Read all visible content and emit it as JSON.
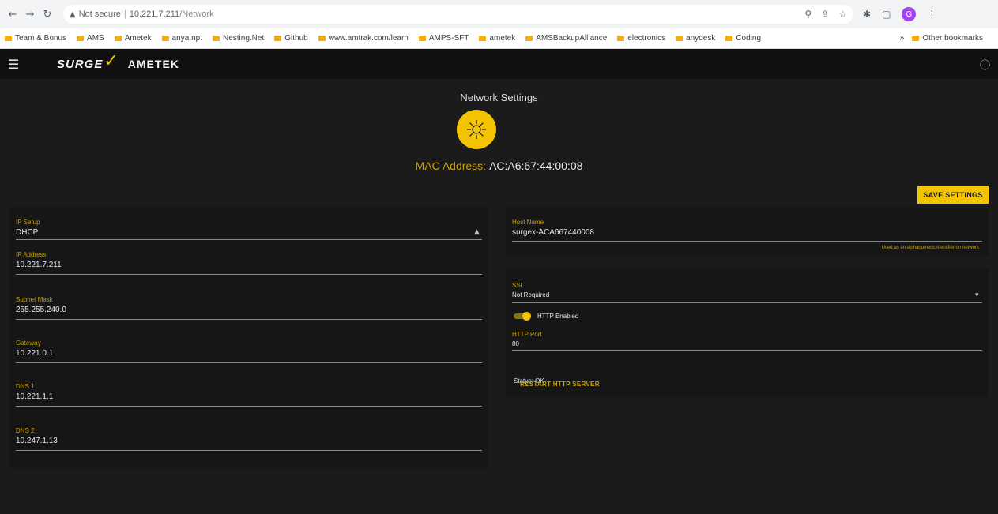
{
  "browser": {
    "url_security": "Not secure",
    "url_host": "10.221.7.211",
    "url_path": "/Network",
    "bookmarks": [
      "Team & Bonus",
      "AMS",
      "Ametek",
      "anya.npt",
      "Nesting.Net",
      "Github",
      "www.amtrak.com/learn",
      "AMPS-SFT",
      "ametek",
      "AMSBackupAlliance",
      "electronics",
      "anydesk",
      "Coding"
    ],
    "other_bookmarks": "Other bookmarks",
    "profile_initial": "G"
  },
  "app": {
    "logo_surge": "SURGE",
    "logo_ametek": "AMETEK",
    "page_title": "Network Settings",
    "mac_label": "MAC Address:",
    "mac_value": "AC:A6:67:44:00:08",
    "save_button": "SAVE SETTINGS"
  },
  "left_panel": {
    "ip_setup_label": "IP Setup",
    "ip_setup_value": "DHCP",
    "ip_address_label": "IP Address",
    "ip_address_value": "10.221.7.211",
    "subnet_label": "Subnet Mask",
    "subnet_value": "255.255.240.0",
    "gateway_label": "Gateway",
    "gateway_value": "10.221.0.1",
    "dns1_label": "DNS 1",
    "dns1_value": "10.221.1.1",
    "dns2_label": "DNS 2",
    "dns2_value": "10.247.1.13"
  },
  "right_panel": {
    "hostname_label": "Host Name",
    "hostname_value": "surgex-ACA667440008",
    "hostname_helper": "Used as an alphanumeric identifier on network",
    "ssl_label": "SSL",
    "ssl_value": "Not Required",
    "http_toggle_label": "HTTP Enabled",
    "http_enabled": true,
    "http_port_label": "HTTP Port",
    "http_port_value": "80",
    "status_text": "Status: OK",
    "restart_button": "RESTART HTTP SERVER"
  },
  "colors": {
    "accent": "#f5c400",
    "background": "#1b1b1b",
    "panel": "#161616"
  }
}
